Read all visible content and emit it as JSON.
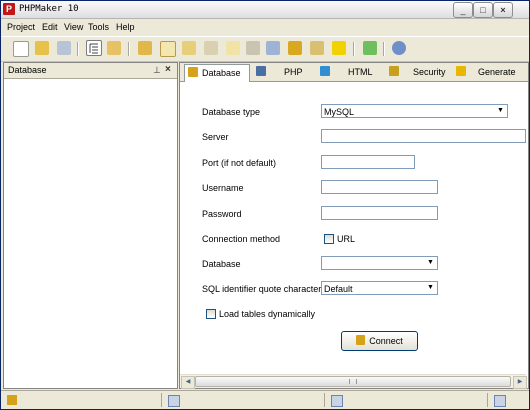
{
  "window": {
    "title": "PHPMaker 10",
    "app_icon": "P"
  },
  "window_buttons": [
    "_",
    "□",
    "×"
  ],
  "menu": [
    {
      "label": "Project"
    },
    {
      "label": "Edit"
    },
    {
      "label": "View"
    },
    {
      "label": "Tools"
    },
    {
      "label": "Help"
    }
  ],
  "toolbar_icons": [
    "new-project-icon",
    "open-project-icon",
    "save-project-icon",
    "tree-view-icon",
    "panel-icon",
    "add-table-icon",
    "table-icon",
    "custom-view-icon",
    "link-table-icon",
    "user-table-icon",
    "edit-table-icon",
    "field-icon",
    "lock-icon",
    "user-levels-icon",
    "generate-icon",
    "refresh-icon",
    "help-icon"
  ],
  "left_panel": {
    "title": "Database",
    "pin_icon": "⊥",
    "close_icon": "×"
  },
  "tabs": [
    {
      "label": "Database",
      "icon": "database-tab-icon",
      "color": "#d6a21a"
    },
    {
      "label": "PHP",
      "icon": "php-tab-icon",
      "color": "#4a6fa5"
    },
    {
      "label": "HTML",
      "icon": "html-tab-icon",
      "color": "#2f8fd0"
    },
    {
      "label": "Security",
      "icon": "security-tab-icon",
      "color": "#c8a020"
    },
    {
      "label": "Generate",
      "icon": "generate-tab-icon",
      "color": "#e8b800"
    }
  ],
  "form": {
    "database_type_label": "Database type",
    "database_type_value": "MySQL",
    "server_label": "Server",
    "server_value": "",
    "port_label": "Port (if not default)",
    "port_value": "",
    "username_label": "Username",
    "username_value": "",
    "password_label": "Password",
    "password_value": "",
    "connection_method_label": "Connection method",
    "url_label": "URL",
    "url_checked": false,
    "database_label": "Database",
    "database_value": "",
    "quote_label": "SQL identifier quote character",
    "quote_value": "Default",
    "load_tables_label": "Load tables dynamically",
    "load_tables_checked": false,
    "connect_label": "Connect"
  },
  "colors": {
    "accent": "#0a246a",
    "field_border": "#7f9db9",
    "chrome": "#ece9d8"
  }
}
